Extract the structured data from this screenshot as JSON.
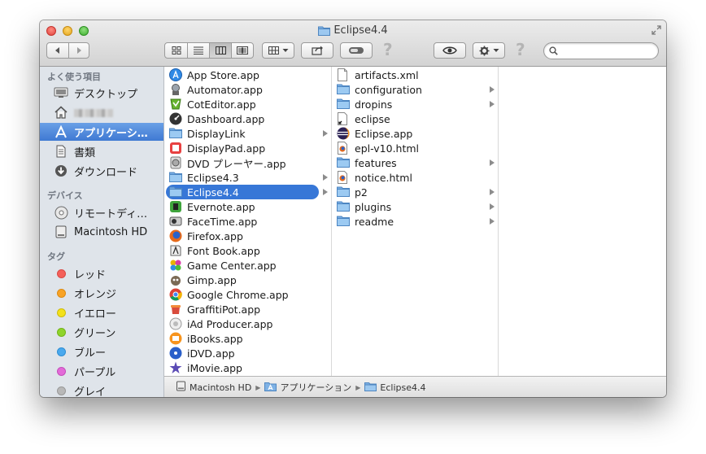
{
  "window": {
    "title": "Eclipse4.4"
  },
  "search": {
    "placeholder": ""
  },
  "sidebar": {
    "sections": [
      {
        "header": "よく使う項目"
      },
      {
        "header": "デバイス"
      },
      {
        "header": "タグ"
      }
    ],
    "favorites": [
      {
        "label": "デスクトップ",
        "icon": "desktop-icon"
      },
      {
        "label": "",
        "icon": "home-icon"
      },
      {
        "label": "アプリケーシ…",
        "icon": "applications-icon"
      },
      {
        "label": "書類",
        "icon": "documents-icon"
      },
      {
        "label": "ダウンロード",
        "icon": "downloads-icon"
      }
    ],
    "devices": [
      {
        "label": "リモートディ…",
        "icon": "remote-disc-icon"
      },
      {
        "label": "Macintosh HD",
        "icon": "hard-drive-icon"
      }
    ],
    "tags": [
      {
        "label": "レッド",
        "color": "#f4605a"
      },
      {
        "label": "オレンジ",
        "color": "#f8a326"
      },
      {
        "label": "イエロー",
        "color": "#f3e11a"
      },
      {
        "label": "グリーン",
        "color": "#8fd42b"
      },
      {
        "label": "ブルー",
        "color": "#4aa9ee"
      },
      {
        "label": "パープル",
        "color": "#e36ad8"
      },
      {
        "label": "グレイ",
        "color": "#b8b8b8"
      }
    ]
  },
  "column1": [
    {
      "label": "App Store.app",
      "icon": "app-store-icon"
    },
    {
      "label": "Automator.app",
      "icon": "automator-icon"
    },
    {
      "label": "CotEditor.app",
      "icon": "coteditor-icon"
    },
    {
      "label": "Dashboard.app",
      "icon": "dashboard-icon"
    },
    {
      "label": "DisplayLink",
      "icon": "folder-icon",
      "folder": true
    },
    {
      "label": "DisplayPad.app",
      "icon": "displaypad-icon"
    },
    {
      "label": "DVD プレーヤー.app",
      "icon": "dvd-player-icon"
    },
    {
      "label": "Eclipse4.3",
      "icon": "folder-icon",
      "folder": true
    },
    {
      "label": "Eclipse4.4",
      "icon": "folder-icon",
      "folder": true,
      "selected": true
    },
    {
      "label": "Evernote.app",
      "icon": "evernote-icon"
    },
    {
      "label": "FaceTime.app",
      "icon": "facetime-icon"
    },
    {
      "label": "Firefox.app",
      "icon": "firefox-icon"
    },
    {
      "label": "Font Book.app",
      "icon": "font-book-icon"
    },
    {
      "label": "Game Center.app",
      "icon": "game-center-icon"
    },
    {
      "label": "Gimp.app",
      "icon": "gimp-icon"
    },
    {
      "label": "Google Chrome.app",
      "icon": "chrome-icon"
    },
    {
      "label": "GraffitiPot.app",
      "icon": "graffitipot-icon"
    },
    {
      "label": "iAd Producer.app",
      "icon": "iad-producer-icon"
    },
    {
      "label": "iBooks.app",
      "icon": "ibooks-icon"
    },
    {
      "label": "iDVD.app",
      "icon": "idvd-icon"
    },
    {
      "label": "iMovie.app",
      "icon": "imovie-icon"
    }
  ],
  "column2": [
    {
      "label": "artifacts.xml",
      "icon": "document-icon"
    },
    {
      "label": "configuration",
      "icon": "folder-icon",
      "folder": true
    },
    {
      "label": "dropins",
      "icon": "folder-icon",
      "folder": true
    },
    {
      "label": "eclipse",
      "icon": "alias-document-icon"
    },
    {
      "label": "Eclipse.app",
      "icon": "eclipse-icon"
    },
    {
      "label": "epl-v10.html",
      "icon": "html-document-icon"
    },
    {
      "label": "features",
      "icon": "folder-icon",
      "folder": true
    },
    {
      "label": "notice.html",
      "icon": "html-document-icon"
    },
    {
      "label": "p2",
      "icon": "folder-icon",
      "folder": true
    },
    {
      "label": "plugins",
      "icon": "folder-icon",
      "folder": true
    },
    {
      "label": "readme",
      "icon": "folder-icon",
      "folder": true
    }
  ],
  "pathbar": [
    {
      "label": "Macintosh HD",
      "icon": "hard-drive-icon"
    },
    {
      "label": "アプリケーション",
      "icon": "applications-folder-icon"
    },
    {
      "label": "Eclipse4.4",
      "icon": "folder-icon"
    }
  ],
  "colors": {
    "selection": "#3777d7",
    "sidebar_selection": "#4a86da",
    "sidebar_bg": "#dfe4ea"
  }
}
